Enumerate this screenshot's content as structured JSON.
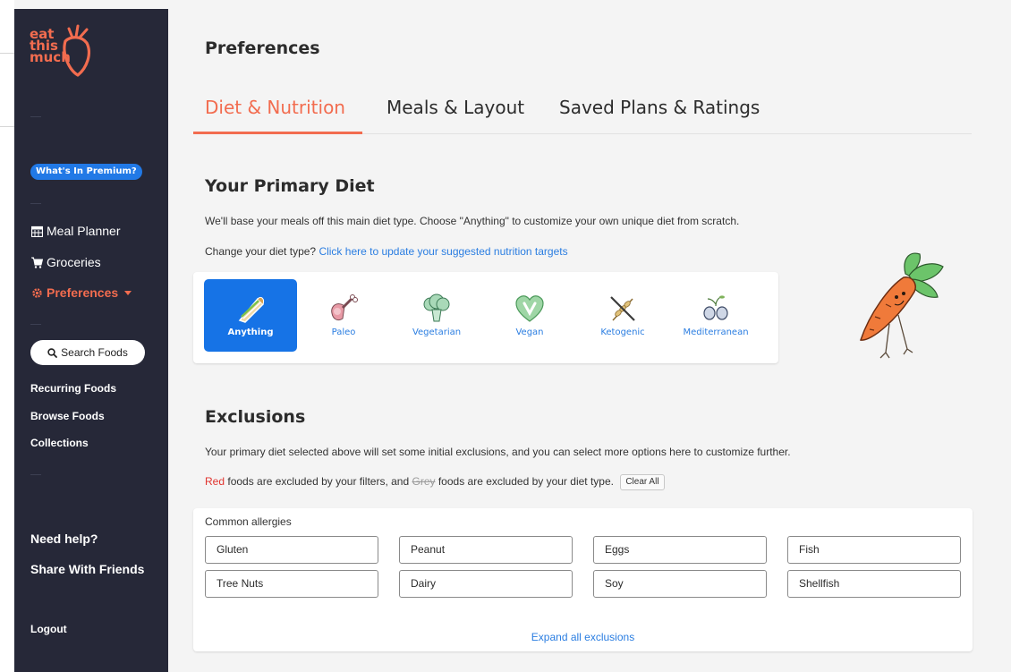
{
  "brand": {
    "logo_lines": [
      "eat",
      "this",
      "much"
    ],
    "accent_color": "#f26c4f",
    "link_color": "#2a7de1",
    "sidebar_color": "#262838"
  },
  "sidebar": {
    "premium_badge": "What's In Premium?",
    "nav": [
      {
        "label": "Meal Planner",
        "icon": "calendar-icon"
      },
      {
        "label": "Groceries",
        "icon": "cart-icon"
      },
      {
        "label": "Preferences",
        "icon": "gear-icon",
        "active": true
      }
    ],
    "search_label": "Search Foods",
    "food_links": [
      "Recurring Foods",
      "Browse Foods",
      "Collections"
    ],
    "help_links": [
      "Need help?",
      "Share With Friends"
    ],
    "logout": "Logout"
  },
  "header": {
    "title": "Preferences"
  },
  "tabs": [
    {
      "label": "Diet & Nutrition",
      "active": true
    },
    {
      "label": "Meals & Layout",
      "active": false
    },
    {
      "label": "Saved Plans & Ratings",
      "active": false
    }
  ],
  "primary_diet": {
    "heading": "Your Primary Diet",
    "description": "We'll base your meals off this main diet type. Choose \"Anything\" to customize your own unique diet from scratch.",
    "change_prefix": "Change your diet type?",
    "change_link": "Click here to update your suggested nutrition targets",
    "options": [
      {
        "label": "Anything",
        "icon": "sandwich-icon",
        "selected": true
      },
      {
        "label": "Paleo",
        "icon": "meat-leg-icon",
        "selected": false
      },
      {
        "label": "Vegetarian",
        "icon": "broccoli-icon",
        "selected": false
      },
      {
        "label": "Vegan",
        "icon": "heart-v-icon",
        "selected": false
      },
      {
        "label": "Ketogenic",
        "icon": "crossed-wheat-icon",
        "selected": false
      },
      {
        "label": "Mediterranean",
        "icon": "olives-icon",
        "selected": false
      }
    ]
  },
  "exclusions": {
    "heading": "Exclusions",
    "description": "Your primary diet selected above will set some initial exclusions, and you can select more options here to customize further.",
    "legend_red": "Red",
    "legend_middle": "foods are excluded by your filters, and",
    "legend_grey": "Grey",
    "legend_end": "foods are excluded by your diet type.",
    "clear_all": "Clear All",
    "group_label": "Common allergies",
    "foods": [
      "Gluten",
      "Peanut",
      "Eggs",
      "Fish",
      "Tree Nuts",
      "Dairy",
      "Soy",
      "Shellfish"
    ],
    "expand_label": "Expand all exclusions"
  }
}
